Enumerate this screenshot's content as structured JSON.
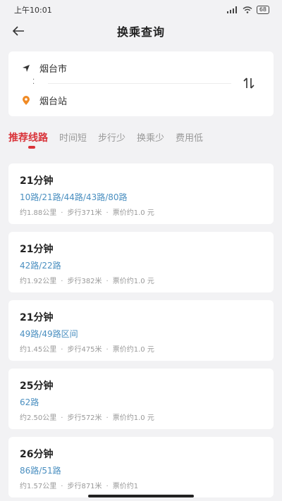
{
  "status": {
    "time": "上午10:01",
    "battery": "68"
  },
  "nav": {
    "title": "换乘查询"
  },
  "route": {
    "start": "烟台市",
    "end": "烟台站"
  },
  "tabs": [
    "推荐线路",
    "时间短",
    "步行少",
    "换乘少",
    "费用低"
  ],
  "results": [
    {
      "duration": "21分钟",
      "lines": "10路/21路/44路/43路/80路",
      "distance": "约1.88公里",
      "walk": "步行371米",
      "fare": "票价约1.0  元"
    },
    {
      "duration": "21分钟",
      "lines": "42路/22路",
      "distance": "约1.92公里",
      "walk": "步行382米",
      "fare": "票价约1.0  元"
    },
    {
      "duration": "21分钟",
      "lines": "49路/49路区间",
      "distance": "约1.45公里",
      "walk": "步行475米",
      "fare": "票价约1.0  元"
    },
    {
      "duration": "25分钟",
      "lines": "62路",
      "distance": "约2.50公里",
      "walk": "步行572米",
      "fare": "票价约1.0  元"
    },
    {
      "duration": "26分钟",
      "lines": "86路/51路",
      "distance": "约1.57公里",
      "walk": "步行871米",
      "fare": "票价约1"
    }
  ],
  "colors": {
    "accent": "#d9343a",
    "link": "#4a8fc0",
    "start_marker": "#333333",
    "end_marker": "#f08a24"
  }
}
